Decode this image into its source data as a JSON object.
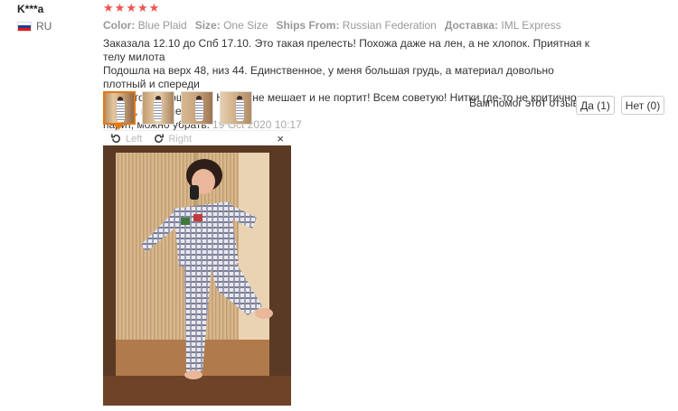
{
  "reviewer": {
    "name": "K***a",
    "country": "RU",
    "flag_colors": [
      "#ffffff",
      "#1c3f94",
      "#e4181c"
    ]
  },
  "rating": {
    "stars": 5,
    "max": 5,
    "color": "#f0544f"
  },
  "meta": [
    {
      "key": "Color:",
      "value": "Blue Plaid"
    },
    {
      "key": "Size:",
      "value": "One Size"
    },
    {
      "key": "Ships From:",
      "value": "Russian Federation"
    },
    {
      "key": "Доставка:",
      "value": "IML Express"
    }
  ],
  "review": {
    "lines": [
      "Заказала 12.10 до Спб 17.10. Это такая прелесть! Похожа даже на лен, а не хлопок. Приятная к телу милота",
      "Подошла на верх 48, низ 44. Единственное, у меня большая грудь, а материал довольно плотный и спереди",
      "немного топорщится.. Но это не мешает и не портит! Всем советую! Нитки где-то не критично торчат, меня не",
      "парит, можно убрать."
    ],
    "date": "19 Oct 2020 10:17"
  },
  "thumbnails": [
    {
      "name": "photo-thumb-1",
      "active": true
    },
    {
      "name": "photo-thumb-2",
      "active": false
    },
    {
      "name": "photo-thumb-3",
      "active": false
    },
    {
      "name": "photo-thumb-4",
      "active": false
    }
  ],
  "helpful": {
    "question": "Вам помог этот отзыв?",
    "yes_label": "Да (1)",
    "no_label": "Нет (0)"
  },
  "viewer": {
    "rotate_left_label": "Left",
    "rotate_right_label": "Right",
    "close_glyph": "×"
  },
  "colors": {
    "accent": "#e47911",
    "star": "#f0544f"
  }
}
